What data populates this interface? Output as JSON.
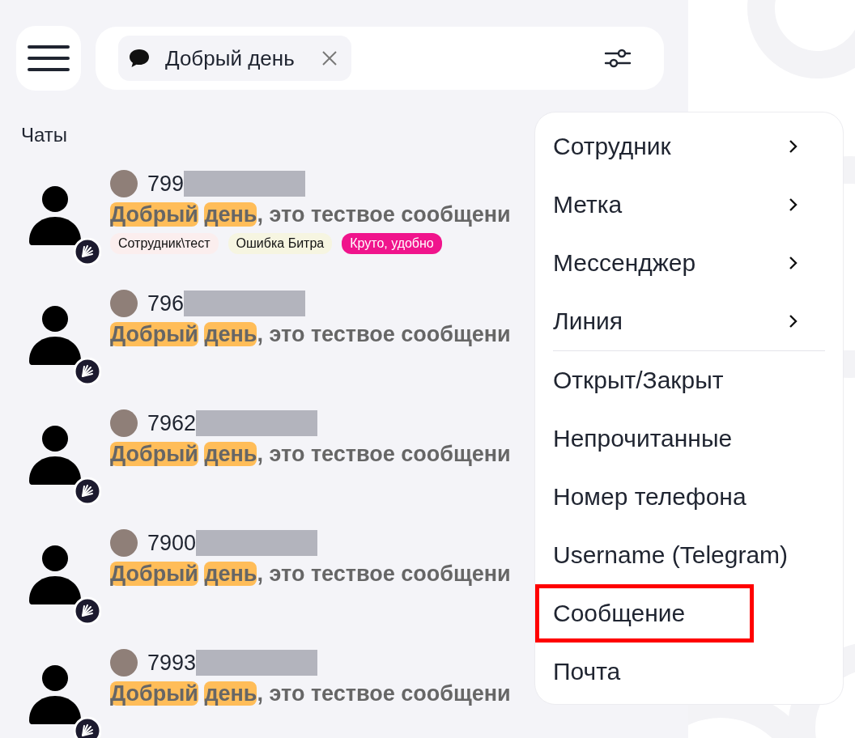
{
  "search": {
    "chip": "Добрый день"
  },
  "section_title": "Чаты",
  "chats": [
    {
      "name": "799",
      "highlights": [
        "Добрый",
        "день"
      ],
      "message": ", это тествое сообщени",
      "tags": [
        {
          "label": "Сотрудник\\тест",
          "color": "#fbeeee"
        },
        {
          "label": "Ошибка Битра",
          "color": "#f6f5e1"
        },
        {
          "label": "Круто, удобно",
          "color": "#f0148c"
        }
      ]
    },
    {
      "name": "796",
      "highlights": [
        "Добрый",
        "день"
      ],
      "message": ", это тествое сообщени"
    },
    {
      "name": "7962",
      "highlights": [
        "Добрый",
        "день"
      ],
      "message": ", это тествое сообщени"
    },
    {
      "name": "7900",
      "highlights": [
        "Добрый",
        "день"
      ],
      "message": ", это тествое сообщени"
    },
    {
      "name": "7993",
      "highlights": [
        "Добрый",
        "день"
      ],
      "message": ", это тествое сообщени"
    }
  ],
  "filter_menu": [
    {
      "label": "Сотрудник",
      "kind": "submenu",
      "selected": false
    },
    {
      "label": "Метка",
      "kind": "submenu",
      "selected": false
    },
    {
      "label": "Мессенджер",
      "kind": "submenu",
      "selected": false
    },
    {
      "label": "Линия",
      "kind": "submenu",
      "selected": false
    },
    {
      "kind": "divider"
    },
    {
      "label": "Открыт/Закрыт",
      "kind": "option",
      "selected": false
    },
    {
      "label": "Непрочитанные",
      "kind": "option",
      "selected": false
    },
    {
      "label": "Номер телефона",
      "kind": "option",
      "selected": false
    },
    {
      "label": "Username (Telegram)",
      "kind": "option",
      "selected": false
    },
    {
      "label": "Сообщение",
      "kind": "option",
      "selected": true
    },
    {
      "label": "Почта",
      "kind": "option",
      "selected": false
    }
  ]
}
